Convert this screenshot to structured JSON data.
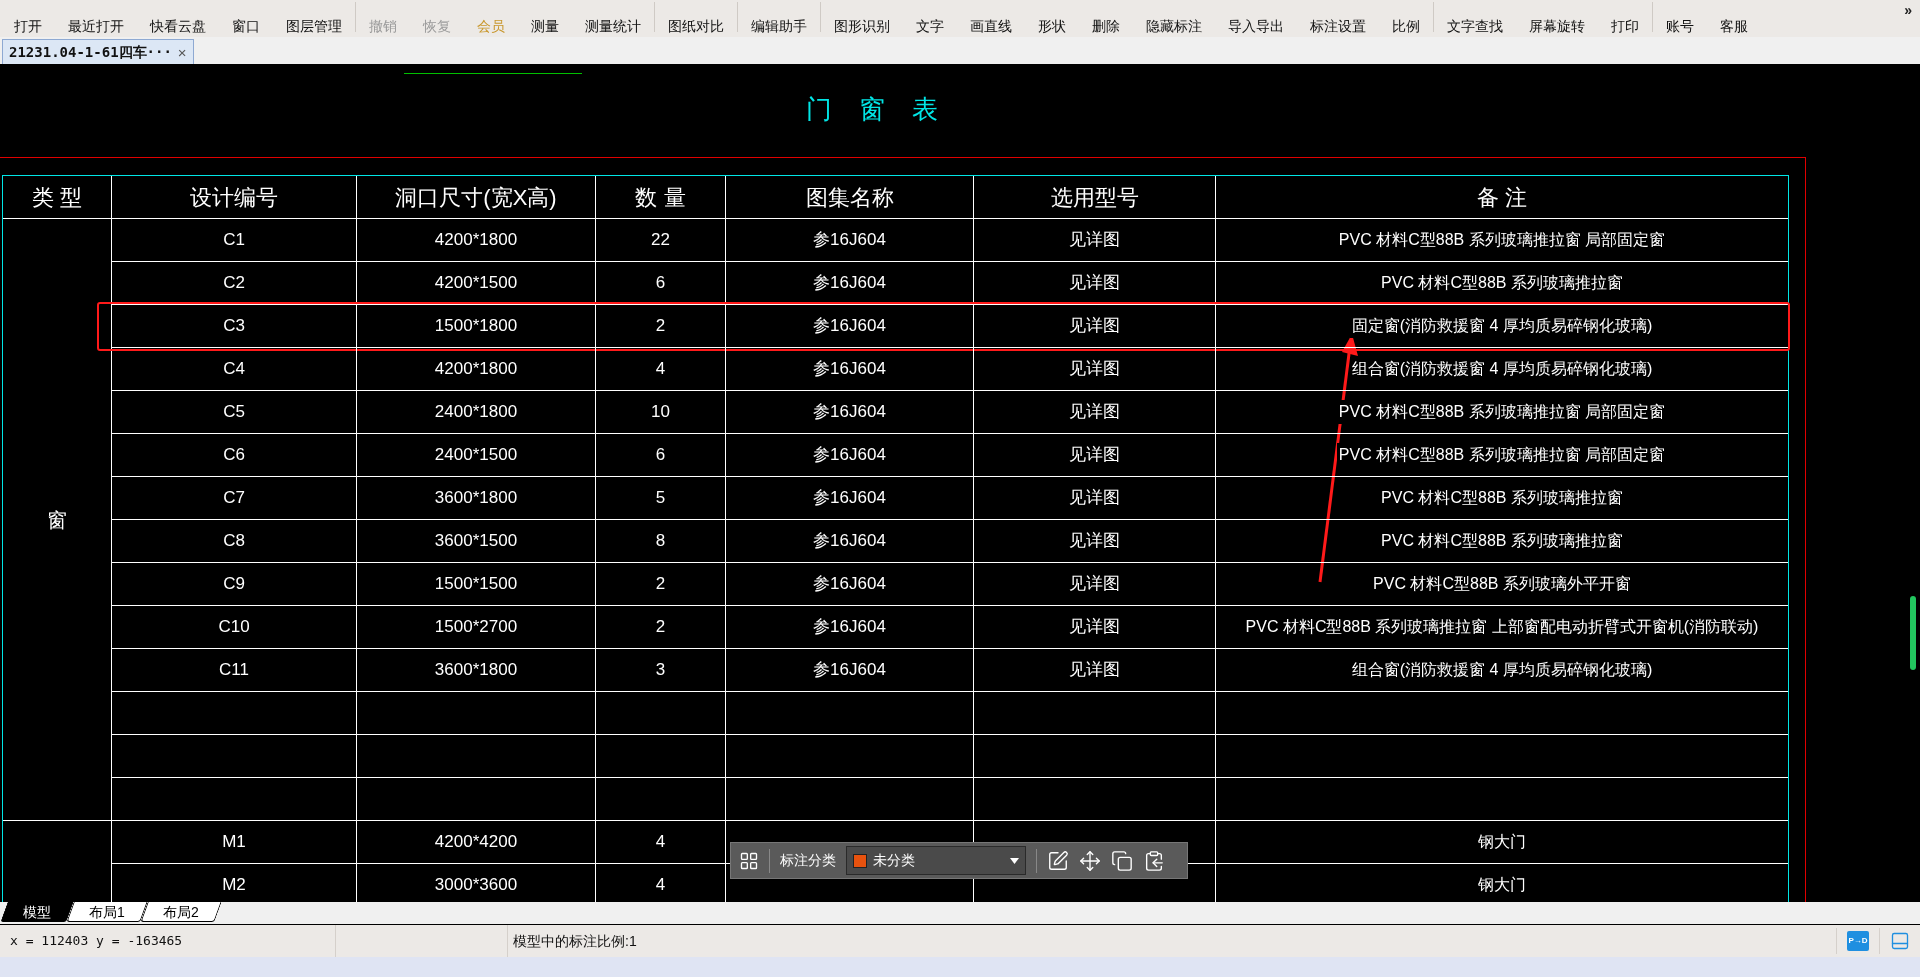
{
  "toolbar": {
    "items": [
      {
        "label": "打开",
        "kind": "normal",
        "separator_before": false
      },
      {
        "label": "最近打开",
        "kind": "normal",
        "separator_before": false
      },
      {
        "label": "快看云盘",
        "kind": "normal",
        "separator_before": false
      },
      {
        "label": "窗口",
        "kind": "normal",
        "separator_before": false
      },
      {
        "label": "图层管理",
        "kind": "normal",
        "separator_before": false
      },
      {
        "label": "撤销",
        "kind": "disabled",
        "separator_before": true
      },
      {
        "label": "恢复",
        "kind": "disabled",
        "separator_before": false
      },
      {
        "label": "会员",
        "kind": "member",
        "separator_before": false
      },
      {
        "label": "测量",
        "kind": "normal",
        "separator_before": false
      },
      {
        "label": "测量统计",
        "kind": "normal",
        "separator_before": false
      },
      {
        "label": "图纸对比",
        "kind": "normal",
        "separator_before": true
      },
      {
        "label": "编辑助手",
        "kind": "normal",
        "separator_before": true
      },
      {
        "label": "图形识别",
        "kind": "normal",
        "separator_before": true
      },
      {
        "label": "文字",
        "kind": "normal",
        "separator_before": false
      },
      {
        "label": "画直线",
        "kind": "normal",
        "separator_before": false
      },
      {
        "label": "形状",
        "kind": "normal",
        "separator_before": false
      },
      {
        "label": "删除",
        "kind": "normal",
        "separator_before": false
      },
      {
        "label": "隐藏标注",
        "kind": "normal",
        "separator_before": false
      },
      {
        "label": "导入导出",
        "kind": "normal",
        "separator_before": false
      },
      {
        "label": "标注设置",
        "kind": "normal",
        "separator_before": false
      },
      {
        "label": "比例",
        "kind": "normal",
        "separator_before": false
      },
      {
        "label": "文字查找",
        "kind": "normal",
        "separator_before": true
      },
      {
        "label": "屏幕旋转",
        "kind": "normal",
        "separator_before": false
      },
      {
        "label": "打印",
        "kind": "normal",
        "separator_before": false
      },
      {
        "label": "账号",
        "kind": "normal",
        "separator_before": true
      },
      {
        "label": "客服",
        "kind": "normal",
        "separator_before": false
      }
    ],
    "more": "»"
  },
  "document_tabs": [
    {
      "label": "21231.04-1-61四车···",
      "selected": true,
      "close": "×"
    }
  ],
  "drawing": {
    "title": "门 窗 表",
    "table": {
      "columns": [
        "类 型",
        "设计编号",
        "洞口尺寸(宽X高)",
        "数 量",
        "图集名称",
        "选用型号",
        "备 注"
      ],
      "groups": [
        {
          "type": "窗",
          "rows": [
            {
              "kind": "data",
              "highlighted": false,
              "cells": [
                "C1",
                "4200*1800",
                "22",
                "参16J604",
                "见详图",
                "PVC 材料C型88B 系列玻璃推拉窗 局部固定窗"
              ]
            },
            {
              "kind": "data",
              "highlighted": false,
              "cells": [
                "C2",
                "4200*1500",
                "6",
                "参16J604",
                "见详图",
                "PVC 材料C型88B 系列玻璃推拉窗"
              ]
            },
            {
              "kind": "data",
              "highlighted": true,
              "cells": [
                "C3",
                "1500*1800",
                "2",
                "参16J604",
                "见详图",
                "固定窗(消防救援窗 4 厚均质易碎钢化玻璃)"
              ]
            },
            {
              "kind": "data",
              "highlighted": false,
              "cells": [
                "C4",
                "4200*1800",
                "4",
                "参16J604",
                "见详图",
                "组合窗(消防救援窗 4 厚均质易碎钢化玻璃)"
              ]
            },
            {
              "kind": "data",
              "highlighted": false,
              "cells": [
                "C5",
                "2400*1800",
                "10",
                "参16J604",
                "见详图",
                "PVC 材料C型88B 系列玻璃推拉窗 局部固定窗"
              ]
            },
            {
              "kind": "data",
              "highlighted": false,
              "cells": [
                "C6",
                "2400*1500",
                "6",
                "参16J604",
                "见详图",
                "PVC 材料C型88B 系列玻璃推拉窗 局部固定窗"
              ]
            },
            {
              "kind": "data",
              "highlighted": false,
              "cells": [
                "C7",
                "3600*1800",
                "5",
                "参16J604",
                "见详图",
                "PVC 材料C型88B 系列玻璃推拉窗"
              ]
            },
            {
              "kind": "data",
              "highlighted": false,
              "cells": [
                "C8",
                "3600*1500",
                "8",
                "参16J604",
                "见详图",
                "PVC 材料C型88B 系列玻璃推拉窗"
              ]
            },
            {
              "kind": "data",
              "highlighted": false,
              "cells": [
                "C9",
                "1500*1500",
                "2",
                "参16J604",
                "见详图",
                "PVC 材料C型88B 系列玻璃外平开窗"
              ]
            },
            {
              "kind": "data",
              "highlighted": false,
              "cells": [
                "C10",
                "1500*2700",
                "2",
                "参16J604",
                "见详图",
                "PVC 材料C型88B 系列玻璃推拉窗 上部窗配电动折臂式开窗机(消防联动)"
              ]
            },
            {
              "kind": "data",
              "highlighted": false,
              "cells": [
                "C11",
                "3600*1800",
                "3",
                "参16J604",
                "见详图",
                "组合窗(消防救援窗 4 厚均质易碎钢化玻璃)"
              ]
            },
            {
              "kind": "blank",
              "highlighted": false
            },
            {
              "kind": "blank",
              "highlighted": false
            },
            {
              "kind": "blank",
              "highlighted": false
            }
          ]
        },
        {
          "rows": [
            {
              "kind": "data",
              "highlighted": false,
              "cells": [
                "M1",
                "4200*4200",
                "4",
                null,
                null,
                "钢大门"
              ]
            },
            {
              "kind": "data",
              "highlighted": false,
              "cells": [
                "M2",
                "3000*3600",
                "4",
                null,
                null,
                "钢大门"
              ]
            }
          ]
        }
      ]
    }
  },
  "annotation_toolbar": {
    "label": "标注分类",
    "category": {
      "value": "未分类",
      "color": "#e8520e"
    }
  },
  "layout_tabs": [
    {
      "label": "模型",
      "selected": true
    },
    {
      "label": "布局1",
      "selected": false
    },
    {
      "label": "布局2",
      "selected": false
    }
  ],
  "status_bar": {
    "coordinates": "x = 112403 y = -163465",
    "scale": "模型中的标注比例:1",
    "mode_button": "P→D"
  }
}
